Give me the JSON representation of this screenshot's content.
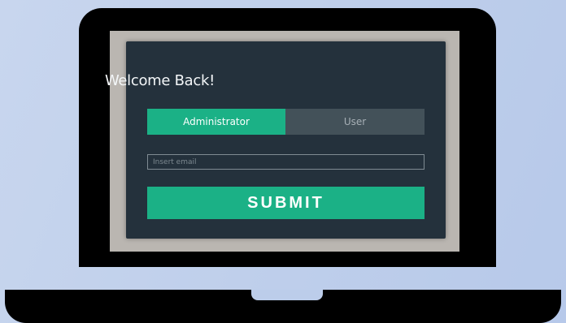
{
  "login": {
    "title": "Welcome Back!",
    "tabs": [
      {
        "label": "Administrator",
        "active": true
      },
      {
        "label": "User",
        "active": false
      }
    ],
    "email": {
      "value": "",
      "placeholder": "Insert email"
    },
    "submit_label": "SUBMIT"
  },
  "colors": {
    "accent": "#1bb186",
    "card_background": "#24313c",
    "inactive_tab": "#435159",
    "page_background": "#c4d3ed",
    "screen_background": "#bab6b1"
  }
}
